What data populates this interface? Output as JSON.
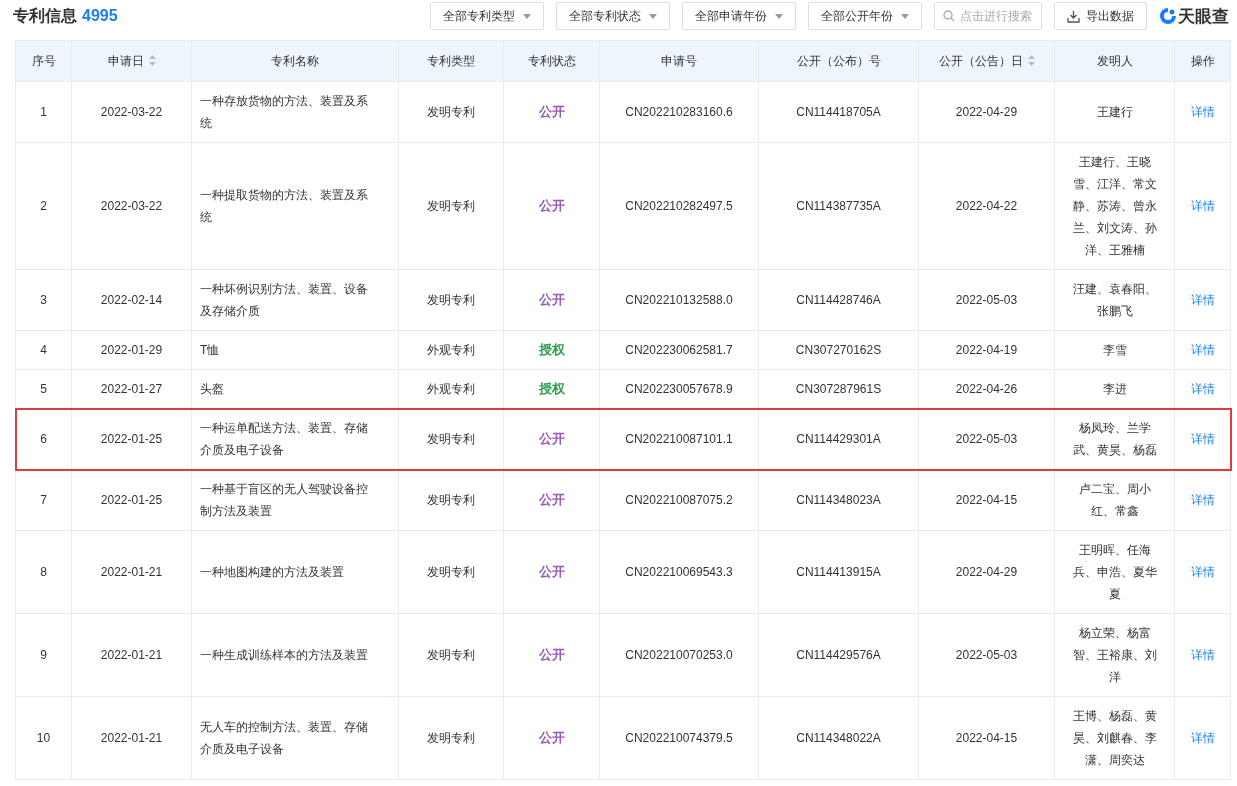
{
  "header": {
    "title": "专利信息",
    "count": "4995",
    "filters": [
      "全部专利类型",
      "全部专利状态",
      "全部申请年份",
      "全部公开年份"
    ],
    "search": {
      "placeholder": "点击进行搜索"
    },
    "export_button": "导出数据",
    "logo": "天眼查"
  },
  "table": {
    "columns": [
      {
        "label": "序号",
        "sortable": false
      },
      {
        "label": "申请日",
        "sortable": true
      },
      {
        "label": "专利名称",
        "sortable": false
      },
      {
        "label": "专利类型",
        "sortable": false
      },
      {
        "label": "专利状态",
        "sortable": false
      },
      {
        "label": "申请号",
        "sortable": false
      },
      {
        "label": "公开（公布）号",
        "sortable": false
      },
      {
        "label": "公开（公告）日",
        "sortable": true
      },
      {
        "label": "发明人",
        "sortable": false
      },
      {
        "label": "操作",
        "sortable": false
      }
    ],
    "rows": [
      {
        "no": "1",
        "date": "2022-03-22",
        "name": "一种存放货物的方法、装置及系统",
        "type": "发明专利",
        "status": {
          "label": "公开",
          "color": "#9b59b6"
        },
        "app_no": "CN202210283160.6",
        "pub_no": "CN114418705A",
        "pub_date": "2022-04-29",
        "inventors": "王建行",
        "action": "详情",
        "highlighted": false
      },
      {
        "no": "2",
        "date": "2022-03-22",
        "name": "一种提取货物的方法、装置及系统",
        "type": "发明专利",
        "status": {
          "label": "公开",
          "color": "#9b59b6"
        },
        "app_no": "CN202210282497.5",
        "pub_no": "CN114387735A",
        "pub_date": "2022-04-22",
        "inventors": "王建行、王晓雪、江洋、常文静、苏涛、曾永兰、刘文涛、孙洋、王雅楠",
        "action": "详情",
        "highlighted": false
      },
      {
        "no": "3",
        "date": "2022-02-14",
        "name": "一种坏例识别方法、装置、设备及存储介质",
        "type": "发明专利",
        "status": {
          "label": "公开",
          "color": "#9b59b6"
        },
        "app_no": "CN202210132588.0",
        "pub_no": "CN114428746A",
        "pub_date": "2022-05-03",
        "inventors": "汪建、袁春阳、张鹏飞",
        "action": "详情",
        "highlighted": false
      },
      {
        "no": "4",
        "date": "2022-01-29",
        "name": "T恤",
        "type": "外观专利",
        "status": {
          "label": "授权",
          "color": "#2e9e4f"
        },
        "app_no": "CN202230062581.7",
        "pub_no": "CN307270162S",
        "pub_date": "2022-04-19",
        "inventors": "李雪",
        "action": "详情",
        "highlighted": false
      },
      {
        "no": "5",
        "date": "2022-01-27",
        "name": "头盔",
        "type": "外观专利",
        "status": {
          "label": "授权",
          "color": "#2e9e4f"
        },
        "app_no": "CN202230057678.9",
        "pub_no": "CN307287961S",
        "pub_date": "2022-04-26",
        "inventors": "李进",
        "action": "详情",
        "highlighted": false
      },
      {
        "no": "6",
        "date": "2022-01-25",
        "name": "一种运单配送方法、装置、存储介质及电子设备",
        "type": "发明专利",
        "status": {
          "label": "公开",
          "color": "#9b59b6"
        },
        "app_no": "CN202210087101.1",
        "pub_no": "CN114429301A",
        "pub_date": "2022-05-03",
        "inventors": "杨凤玲、兰学武、黄昊、杨磊",
        "action": "详情",
        "highlighted": true
      },
      {
        "no": "7",
        "date": "2022-01-25",
        "name": "一种基于盲区的无人驾驶设备控制方法及装置",
        "type": "发明专利",
        "status": {
          "label": "公开",
          "color": "#9b59b6"
        },
        "app_no": "CN202210087075.2",
        "pub_no": "CN114348023A",
        "pub_date": "2022-04-15",
        "inventors": "卢二宝、周小红、常鑫",
        "action": "详情",
        "highlighted": false
      },
      {
        "no": "8",
        "date": "2022-01-21",
        "name": "一种地图构建的方法及装置",
        "type": "发明专利",
        "status": {
          "label": "公开",
          "color": "#9b59b6"
        },
        "app_no": "CN202210069543.3",
        "pub_no": "CN114413915A",
        "pub_date": "2022-04-29",
        "inventors": "王明晖、任海兵、申浩、夏华夏",
        "action": "详情",
        "highlighted": false
      },
      {
        "no": "9",
        "date": "2022-01-21",
        "name": "一种生成训练样本的方法及装置",
        "type": "发明专利",
        "status": {
          "label": "公开",
          "color": "#9b59b6"
        },
        "app_no": "CN202210070253.0",
        "pub_no": "CN114429576A",
        "pub_date": "2022-05-03",
        "inventors": "杨立荣、杨富智、王裕康、刘洋",
        "action": "详情",
        "highlighted": false
      },
      {
        "no": "10",
        "date": "2022-01-21",
        "name": "无人车的控制方法、装置、存储介质及电子设备",
        "type": "发明专利",
        "status": {
          "label": "公开",
          "color": "#9b59b6"
        },
        "app_no": "CN202210074379.5",
        "pub_no": "CN114348022A",
        "pub_date": "2022-04-15",
        "inventors": "王博、杨磊、黄昊、刘麒春、李潇、周奕达",
        "action": "详情",
        "highlighted": false
      }
    ]
  }
}
